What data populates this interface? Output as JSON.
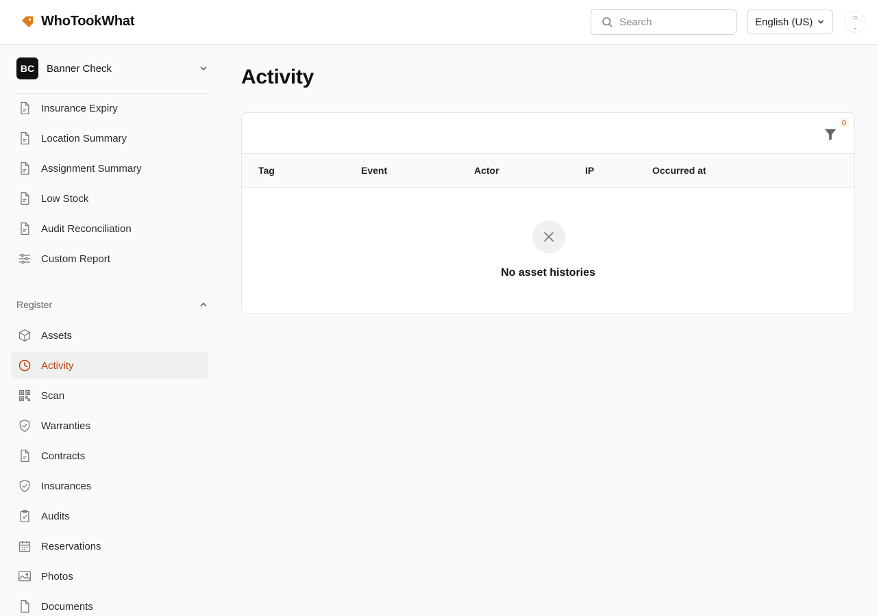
{
  "app": {
    "name": "WhoTookWhat"
  },
  "header": {
    "search_placeholder": "Search",
    "language": "English (US)"
  },
  "org": {
    "initials": "BC",
    "name": "Banner Check"
  },
  "sidebar": {
    "reports": [
      {
        "label": "Insurance Expiry",
        "icon": "document-icon"
      },
      {
        "label": "Location Summary",
        "icon": "document-icon"
      },
      {
        "label": "Assignment Summary",
        "icon": "document-icon"
      },
      {
        "label": "Low Stock",
        "icon": "document-icon"
      },
      {
        "label": "Audit Reconciliation",
        "icon": "document-icon"
      },
      {
        "label": "Custom Report",
        "icon": "sliders-icon"
      }
    ],
    "register_section": "Register",
    "register": [
      {
        "label": "Assets",
        "icon": "box-icon"
      },
      {
        "label": "Activity",
        "icon": "clock-icon"
      },
      {
        "label": "Scan",
        "icon": "qr-icon"
      },
      {
        "label": "Warranties",
        "icon": "shield-check-icon"
      },
      {
        "label": "Contracts",
        "icon": "document-icon"
      },
      {
        "label": "Insurances",
        "icon": "shield-check-icon"
      },
      {
        "label": "Audits",
        "icon": "clipboard-check-icon"
      },
      {
        "label": "Reservations",
        "icon": "calendar-icon"
      },
      {
        "label": "Photos",
        "icon": "image-icon"
      },
      {
        "label": "Documents",
        "icon": "file-icon"
      }
    ]
  },
  "main": {
    "title": "Activity",
    "filter_count": "0",
    "columns": [
      "Tag",
      "Event",
      "Actor",
      "IP",
      "Occurred at"
    ],
    "empty_text": "No asset histories"
  },
  "colors": {
    "accent": "#c2410c",
    "brand_tag": "#e07b1a"
  }
}
